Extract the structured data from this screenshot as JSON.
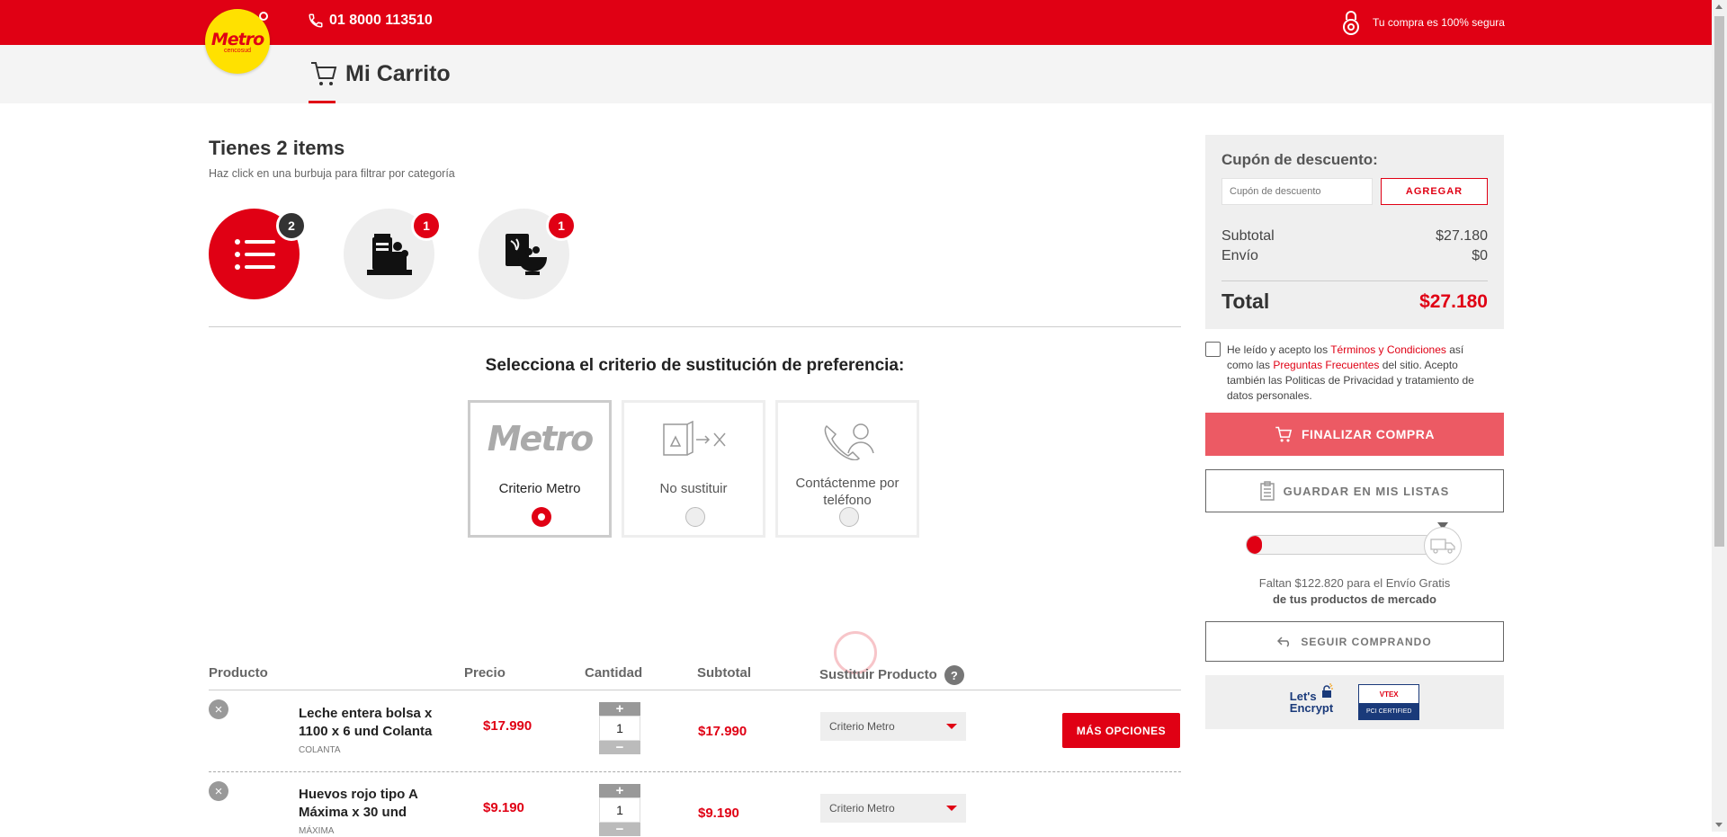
{
  "header": {
    "logo_text": "Metro",
    "logo_sub": "cencosud",
    "phone": "01 8000 113510",
    "secure_text": "Tu compra es 100% segura",
    "page_title": "Mi Carrito"
  },
  "items": {
    "title": "Tienes 2 items",
    "subtitle": "Haz click en una burbuja para filtrar por categoría",
    "bubbles": [
      {
        "name": "all-categories",
        "icon": "list-icon",
        "count": "2"
      },
      {
        "name": "dairy-category",
        "icon": "dairy-products-icon",
        "count": "1"
      },
      {
        "name": "breakfast-category",
        "icon": "cereal-bowl-icon",
        "count": "1"
      }
    ]
  },
  "criteria": {
    "title": "Selecciona el criterio de sustitución de preferencia:",
    "options": [
      {
        "label": "Criterio Metro",
        "logo": "Metro",
        "selected": true
      },
      {
        "label": "No sustituir",
        "selected": false
      },
      {
        "label": "Contáctenme por teléfono",
        "selected": false
      }
    ]
  },
  "table": {
    "headers": {
      "product": "Producto",
      "price": "Precio",
      "quantity": "Cantidad",
      "subtotal": "Subtotal",
      "substitute": "Sustituir Producto",
      "help": "?"
    },
    "rows": [
      {
        "name": "Leche entera bolsa x 1100 x 6 und Colanta",
        "brand": "COLANTA",
        "price": "$17.990",
        "qty": "1",
        "subtotal": "$17.990",
        "substitute": "Criterio Metro"
      },
      {
        "name": "Huevos rojo tipo A Máxima x 30 und",
        "brand": "MÁXIMA",
        "price": "$9.190",
        "qty": "1",
        "subtotal": "$9.190",
        "substitute": "Criterio Metro"
      }
    ],
    "more_options": "MÁS OPCIONES",
    "plus": "+",
    "minus": "−",
    "remove": "×"
  },
  "summary": {
    "coupon_label": "Cupón de descuento:",
    "coupon_placeholder": "Cupón de descuento",
    "coupon_button": "AGREGAR",
    "subtotal_label": "Subtotal",
    "subtotal_value": "$27.180",
    "shipping_label": "Envío",
    "shipping_value": "$0",
    "total_label": "Total",
    "total_value": "$27.180"
  },
  "terms": {
    "part1": "He leído y acepto los ",
    "link1": "Términos y Condiciones",
    "part2": " así como las ",
    "link2": "Preguntas Frecuentes",
    "part3": " del sitio. Acepto también las Politicas de Privacidad y tratamiento de datos personales."
  },
  "actions": {
    "finalize": "FINALIZAR COMPRA",
    "save_lists": "GUARDAR EN MIS LISTAS",
    "continue": "SEGUIR COMPRANDO"
  },
  "shipping": {
    "progress_fraction": 0.08,
    "line1": "Faltan $122.820 para el Envío Gratis",
    "line2": "de tus productos de mercado"
  },
  "certs": {
    "letsencrypt_line1": "Let's",
    "letsencrypt_line2": "Encrypt",
    "vtex_top": "VTEX",
    "vtex_bottom": "PCI CERTIFIED"
  },
  "colors": {
    "brand_red": "#e00014",
    "logo_yellow": "#ffe100",
    "finalize_button": "#ec5a64"
  }
}
